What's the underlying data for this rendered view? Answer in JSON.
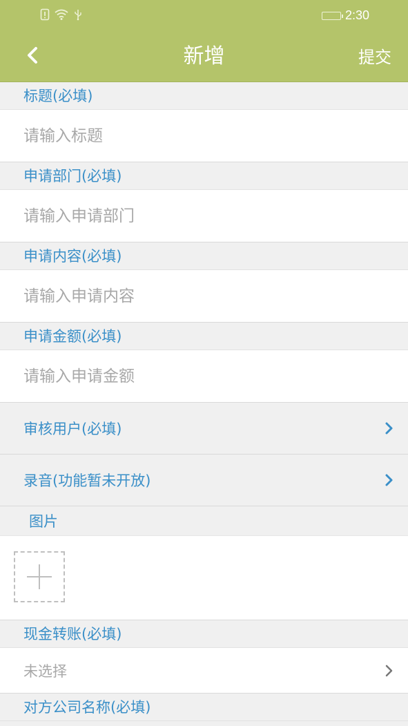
{
  "status_bar": {
    "time": "2:30",
    "icons": [
      "sim-alert-icon",
      "wifi-icon",
      "usb-icon",
      "battery-icon"
    ]
  },
  "nav": {
    "title": "新增",
    "submit_label": "提交",
    "back_icon": "chevron-left-icon"
  },
  "form": {
    "title": {
      "label": "标题(必填)",
      "placeholder": "请输入标题"
    },
    "department": {
      "label": "申请部门(必填)",
      "placeholder": "请输入申请部门"
    },
    "content": {
      "label": "申请内容(必填)",
      "placeholder": "请输入申请内容"
    },
    "amount": {
      "label": "申请金额(必填)",
      "placeholder": "请输入申请金额"
    },
    "reviewer": {
      "label": "审核用户(必填)"
    },
    "recording": {
      "label": "录音(功能暂未开放)"
    },
    "images": {
      "label": "图片",
      "add_icon": "plus-icon"
    },
    "cash_transfer": {
      "label": "现金转账(必填)",
      "value": "未选择"
    },
    "counterparty": {
      "label": "对方公司名称(必填)"
    }
  },
  "colors": {
    "header_bg": "#b4c46a",
    "label_blue": "#3a8fc8",
    "page_bg": "#f0f0f0",
    "placeholder_gray": "#a8a8a8"
  }
}
